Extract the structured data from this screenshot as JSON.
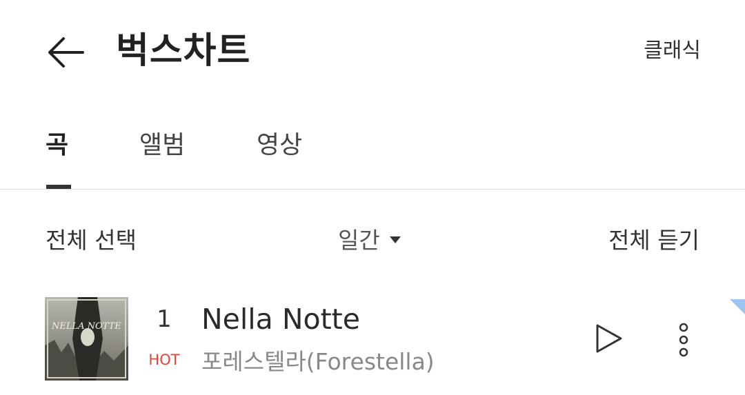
{
  "header": {
    "title": "벅스차트",
    "back_icon": "arrow-left-icon",
    "classic_label": "클래식"
  },
  "tabs": [
    {
      "label": "곡",
      "active": true
    },
    {
      "label": "앨범",
      "active": false
    },
    {
      "label": "영상",
      "active": false
    }
  ],
  "toolbar": {
    "select_all_label": "전체 선택",
    "period_label": "일간",
    "period_icon": "caret-down-icon",
    "play_all_label": "전체 듣기"
  },
  "tracks": [
    {
      "rank": "1",
      "badge": "HOT",
      "title": "Nella Notte",
      "artist": "포레스텔라(Forestella)",
      "album_art_text": "NELLA NOTTE",
      "play_icon": "play-icon",
      "more_icon": "more-vertical-icon"
    }
  ],
  "colors": {
    "accent_hot": "#e0453a",
    "corner_flag": "#9dc3f0"
  }
}
